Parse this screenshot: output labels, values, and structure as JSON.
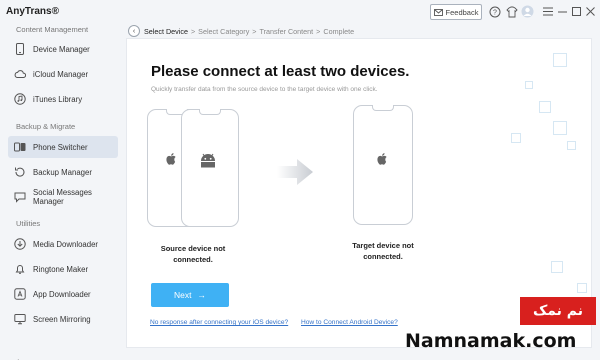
{
  "app": {
    "title": "AnyTrans®"
  },
  "titlebar": {
    "feedback_label": "Feedback",
    "icons": [
      "mail-icon",
      "question-icon",
      "shirt-icon",
      "avatar-icon",
      "menu-icon",
      "minimize-icon",
      "maximize-icon",
      "close-icon"
    ]
  },
  "sidebar": {
    "sections": [
      {
        "label": "Content Management"
      },
      {
        "label": "Backup & Migrate"
      },
      {
        "label": "Utilities"
      }
    ],
    "items": [
      {
        "label": "Device Manager",
        "icon": "phone-icon"
      },
      {
        "label": "iCloud Manager",
        "icon": "cloud-icon"
      },
      {
        "label": "iTunes Library",
        "icon": "music-icon"
      },
      {
        "label": "Phone Switcher",
        "icon": "switch-icon",
        "active": true
      },
      {
        "label": "Backup Manager",
        "icon": "backup-icon"
      },
      {
        "label": "Social Messages Manager",
        "icon": "chat-icon"
      },
      {
        "label": "Media Downloader",
        "icon": "download-icon"
      },
      {
        "label": "Ringtone Maker",
        "icon": "bell-icon"
      },
      {
        "label": "App Downloader",
        "icon": "app-icon"
      },
      {
        "label": "Screen Mirroring",
        "icon": "mirror-icon"
      }
    ]
  },
  "breadcrumb": {
    "steps": [
      "Select Device",
      "Select Category",
      "Transfer Content",
      "Complete"
    ],
    "separator": ">"
  },
  "main": {
    "heading": "Please connect at least two devices.",
    "subtitle": "Quickly transfer data from the source device to the target device with one click.",
    "source_status_line1": "Source device not",
    "source_status_line2": "connected.",
    "target_status_line1": "Target device not",
    "target_status_line2": "connected.",
    "next_label": "Next",
    "help_link_ios": "No response after connecting your iOS device?",
    "help_link_android": "How to Connect Android Device?"
  },
  "watermark": {
    "badge": "نم نمک",
    "site": "Namnamak.com"
  },
  "colors": {
    "accent": "#3fb1f4",
    "link": "#3472c8",
    "active_nav": "#dde4ee",
    "watermark_red": "#d8201e"
  }
}
